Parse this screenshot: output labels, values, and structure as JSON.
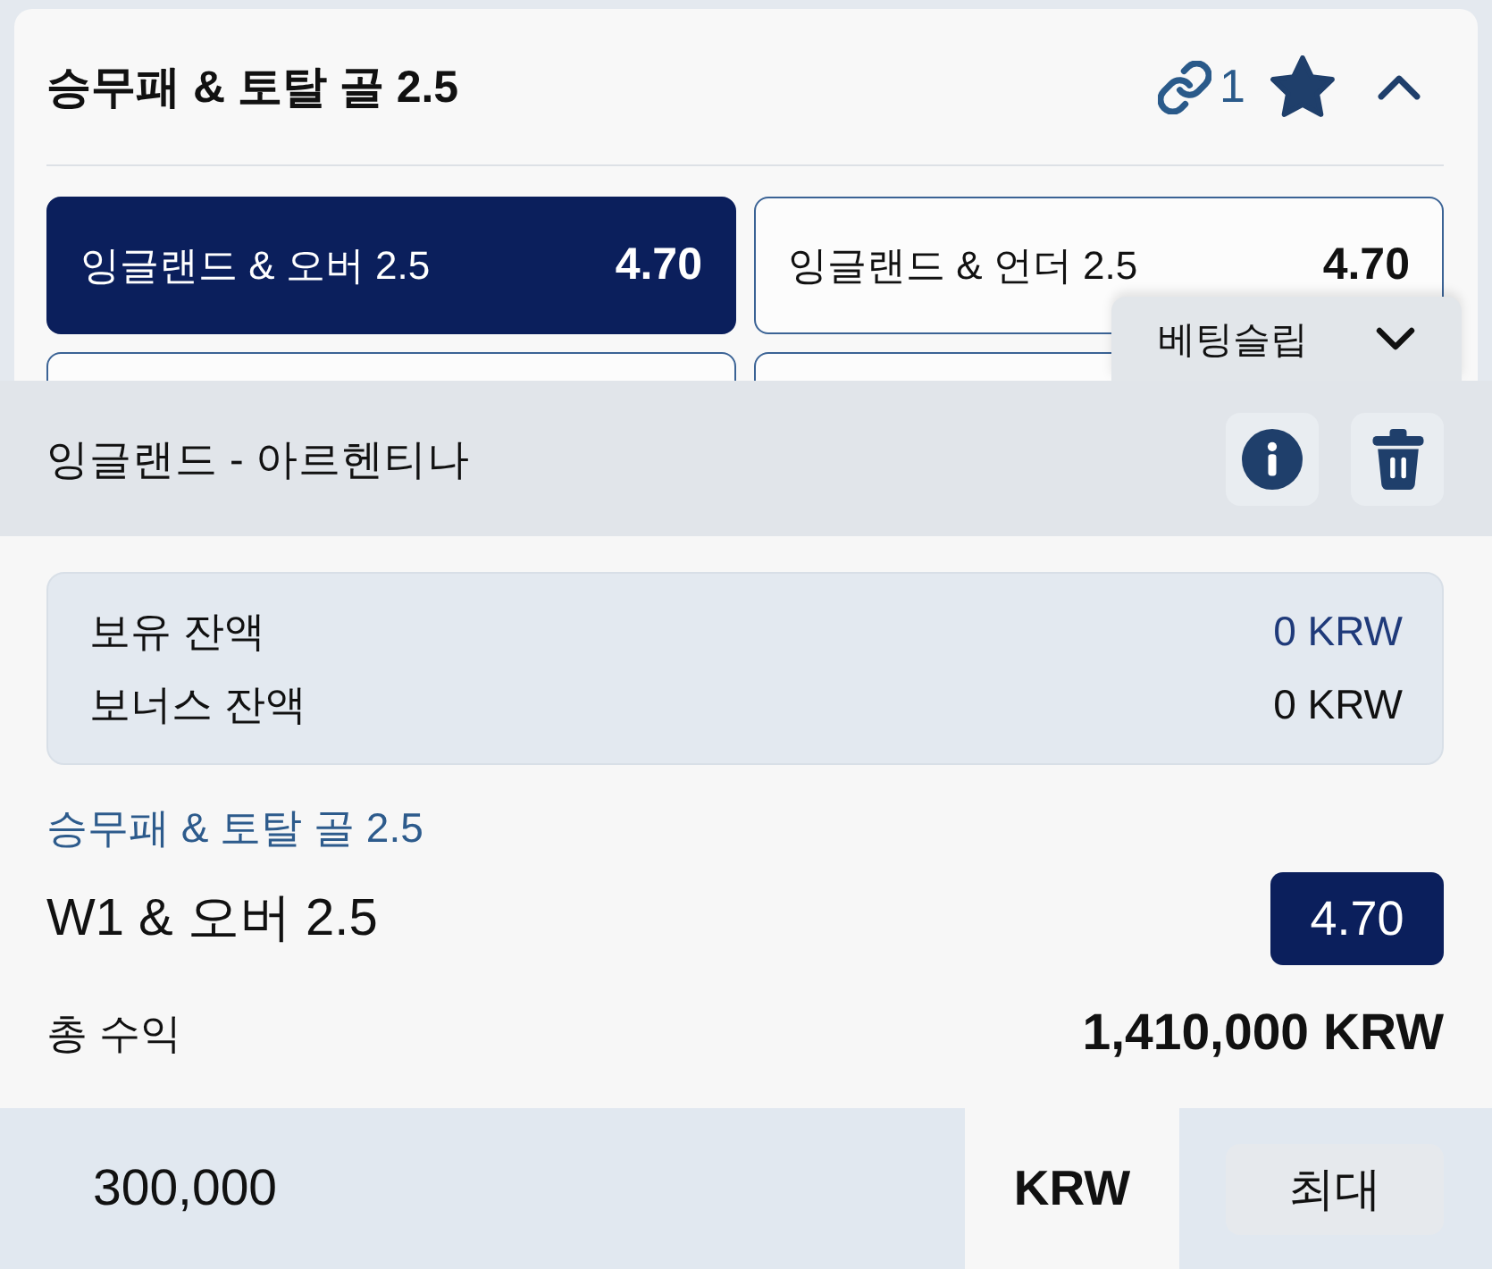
{
  "market": {
    "title": "승무패 & 토탈 골 2.5",
    "linked_count": "1",
    "favorite": true,
    "expanded": true
  },
  "options": [
    {
      "label": "잉글랜드 & 오버 2.5",
      "odds": "4.70",
      "selected": true
    },
    {
      "label": "잉글랜드 & 언더 2.5",
      "odds": "4.70",
      "selected": false
    },
    {
      "selected": false
    },
    {
      "selected": false
    }
  ],
  "betslip": {
    "tab_label": "베팅슬립",
    "expanded": true,
    "event": "잉글랜드 - 아르헨티나"
  },
  "balances": [
    {
      "label": "보유 잔액",
      "amount": "0 KRW",
      "kind": "real"
    },
    {
      "label": "보너스 잔액",
      "amount": "0 KRW",
      "kind": "bonus"
    }
  ],
  "selection": {
    "market": "승무패 & 토탈 골 2.5",
    "pick": "W1 & 오버 2.5",
    "odds": "4.70"
  },
  "payout": {
    "label": "총 수익",
    "amount": "1,410,000 KRW"
  },
  "stake": {
    "value": "300,000",
    "currency": "KRW",
    "max_label": "최대"
  }
}
